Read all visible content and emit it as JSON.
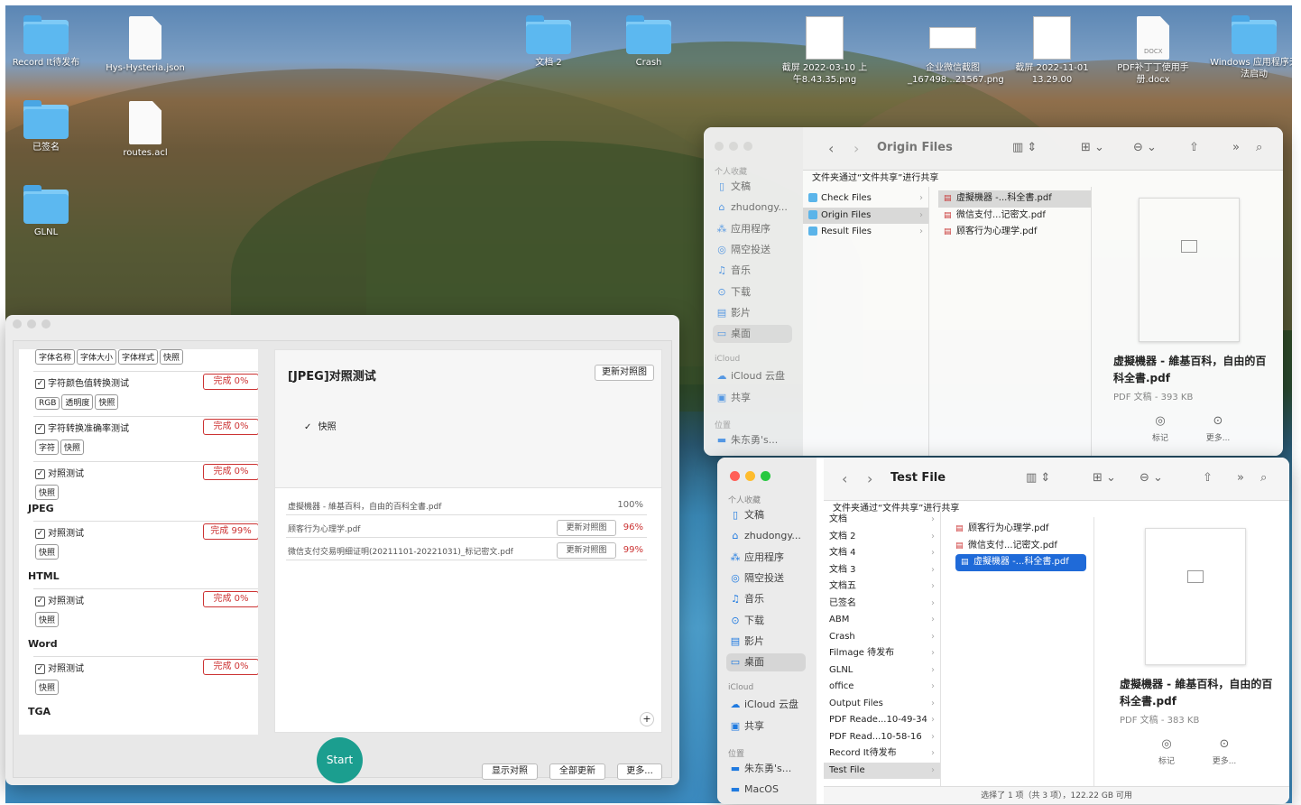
{
  "desktop": {
    "icons": [
      {
        "label": "Record It待发布",
        "type": "folder"
      },
      {
        "label": "Hys-Hysteria.json",
        "type": "doc"
      },
      {
        "label": "文档 2",
        "type": "folder"
      },
      {
        "label": "Crash",
        "type": "folder"
      },
      {
        "label": "截屏 2022-03-10 上午8.43.35.png",
        "type": "thumb"
      },
      {
        "label": "企业微信截图_167498...21567.png",
        "type": "thumb-wide"
      },
      {
        "label": "截屏 2022-11-01 13.29.00",
        "type": "thumb"
      },
      {
        "label": "PDF补丁丁使用手册.docx",
        "type": "docx",
        "badge": "DOCX"
      },
      {
        "label": "Windows 应用程序无法启动",
        "type": "folder"
      },
      {
        "label": "已签名",
        "type": "folder"
      },
      {
        "label": "routes.acl",
        "type": "doc"
      },
      {
        "label": "GLNL",
        "type": "folder"
      }
    ]
  },
  "app": {
    "left": {
      "tags_top": [
        "字体名称",
        "字体大小",
        "字体样式",
        "快照"
      ],
      "rows": [
        {
          "label": "字符颜色值转换测试",
          "status": "完成 0%",
          "tags": [
            "RGB",
            "透明度",
            "快照"
          ]
        },
        {
          "label": "字符转换准确率测试",
          "status": "完成 0%",
          "tags": [
            "字符",
            "快照"
          ]
        },
        {
          "label": "对照测试",
          "status": "完成 0%",
          "tags": [
            "快照"
          ]
        }
      ],
      "sections": [
        {
          "title": "JPEG",
          "label": "对照测试",
          "status": "完成 99%",
          "tags": [
            "快照"
          ]
        },
        {
          "title": "HTML",
          "label": "对照测试",
          "status": "完成 0%",
          "tags": [
            "快照"
          ]
        },
        {
          "title": "Word",
          "label": "对照测试",
          "status": "完成 0%",
          "tags": [
            "快照"
          ]
        },
        {
          "title": "TGA"
        }
      ],
      "check_mark": "✓"
    },
    "right": {
      "title": "[JPEG]对照测试",
      "update_ref_label": "更新对照图",
      "snapshot_label": "快照",
      "files": [
        {
          "name": "虚擬機器 - 維基百科，自由的百科全書.pdf",
          "pct": "100%",
          "button": ""
        },
        {
          "name": "顾客行为心理学.pdf",
          "pct": "96%",
          "button": "更新对照图"
        },
        {
          "name": "微信支付交易明细证明(20211101-20221031)_标记密文.pdf",
          "pct": "99%",
          "button": "更新对照图"
        }
      ],
      "plus": "+"
    },
    "start_label": "Start",
    "footer_buttons": [
      "显示对照",
      "全部更新",
      "更多..."
    ]
  },
  "finder1": {
    "title": "Origin Files",
    "share_note": "文件夹通过“文件共享”进行共享",
    "sidebar": {
      "favorites_header": "个人收藏",
      "favorites": [
        {
          "icon": "doc-icon",
          "glyph": "▯",
          "label": "文稿"
        },
        {
          "icon": "home-icon",
          "glyph": "⌂",
          "label": "zhudongy..."
        },
        {
          "icon": "apps-icon",
          "glyph": "⁂",
          "label": "应用程序"
        },
        {
          "icon": "airdrop-icon",
          "glyph": "◎",
          "label": "隔空投送"
        },
        {
          "icon": "music-icon",
          "glyph": "♫",
          "label": "音乐"
        },
        {
          "icon": "download-icon",
          "glyph": "⊙",
          "label": "下载"
        },
        {
          "icon": "movie-icon",
          "glyph": "▤",
          "label": "影片"
        },
        {
          "icon": "desktop-icon",
          "glyph": "▭",
          "label": "桌面"
        }
      ],
      "icloud_header": "iCloud",
      "icloud": [
        {
          "icon": "cloud-icon",
          "glyph": "☁",
          "label": "iCloud 云盘"
        },
        {
          "icon": "shared-icon",
          "glyph": "▣",
          "label": "共享"
        }
      ],
      "locations_header": "位置",
      "locations": [
        {
          "icon": "computer-icon",
          "glyph": "▬",
          "label": "朱东勇's..."
        }
      ]
    },
    "col1": [
      "Check Files",
      "Origin Files",
      "Result Files"
    ],
    "col2": [
      "虚擬機器 -...科全書.pdf",
      "微信支付...记密文.pdf",
      "顾客行为心理学.pdf"
    ],
    "preview": {
      "title": "虚擬機器 - 維基百科，自由的百科全書.pdf",
      "meta": "PDF 文稿 - 393 KB",
      "tag": "标记",
      "more": "更多..."
    }
  },
  "finder2": {
    "title": "Test File",
    "share_note": "文件夹通过“文件共享”进行共享",
    "sidebar": {
      "favorites_header": "个人收藏",
      "favorites": [
        {
          "icon": "doc-icon",
          "glyph": "▯",
          "label": "文稿"
        },
        {
          "icon": "home-icon",
          "glyph": "⌂",
          "label": "zhudongy..."
        },
        {
          "icon": "apps-icon",
          "glyph": "⁂",
          "label": "应用程序"
        },
        {
          "icon": "airdrop-icon",
          "glyph": "◎",
          "label": "隔空投送"
        },
        {
          "icon": "music-icon",
          "glyph": "♫",
          "label": "音乐"
        },
        {
          "icon": "download-icon",
          "glyph": "⊙",
          "label": "下载"
        },
        {
          "icon": "movie-icon",
          "glyph": "▤",
          "label": "影片"
        },
        {
          "icon": "desktop-icon",
          "glyph": "▭",
          "label": "桌面"
        }
      ],
      "icloud_header": "iCloud",
      "icloud": [
        {
          "icon": "cloud-icon",
          "glyph": "☁",
          "label": "iCloud 云盘"
        },
        {
          "icon": "shared-icon",
          "glyph": "▣",
          "label": "共享"
        }
      ],
      "locations_header": "位置",
      "locations": [
        {
          "icon": "computer-icon",
          "glyph": "▬",
          "label": "朱东勇's..."
        },
        {
          "icon": "disk-icon",
          "glyph": "▬",
          "label": "MacOS"
        }
      ]
    },
    "col1": [
      "文档",
      "文档 2",
      "文档 4",
      "文档 3",
      "文档五",
      "已签名",
      "ABM",
      "Crash",
      "Filmage 待发布",
      "GLNL",
      "office",
      "Output Files",
      "PDF Reade...10-49-34",
      "PDF Read...10-58-16",
      "Record It待发布",
      "Test File"
    ],
    "col2": [
      "顾客行为心理学.pdf",
      "微信支付...记密文.pdf",
      "虚擬機器 -...科全書.pdf"
    ],
    "preview": {
      "title": "虚擬機器 - 維基百科，自由的百科全書.pdf",
      "meta": "PDF 文稿 - 383 KB",
      "tag": "标记",
      "more": "更多..."
    },
    "status": "选择了 1 项（共 3 项），122.22 GB 可用"
  },
  "toolbar_glyphs": {
    "back": "‹",
    "forward": "›",
    "columns": "▥ ⇕",
    "group": "⊞ ⌄",
    "action": "⊖ ⌄",
    "share": "⇧",
    "more": "»",
    "search": "⌕",
    "chevron": "›"
  },
  "colors": {
    "accent": "#1f6ad8",
    "done_red": "#cc3333",
    "start_teal": "#1b9e8f",
    "folder_blue": "#5cb8f0"
  }
}
